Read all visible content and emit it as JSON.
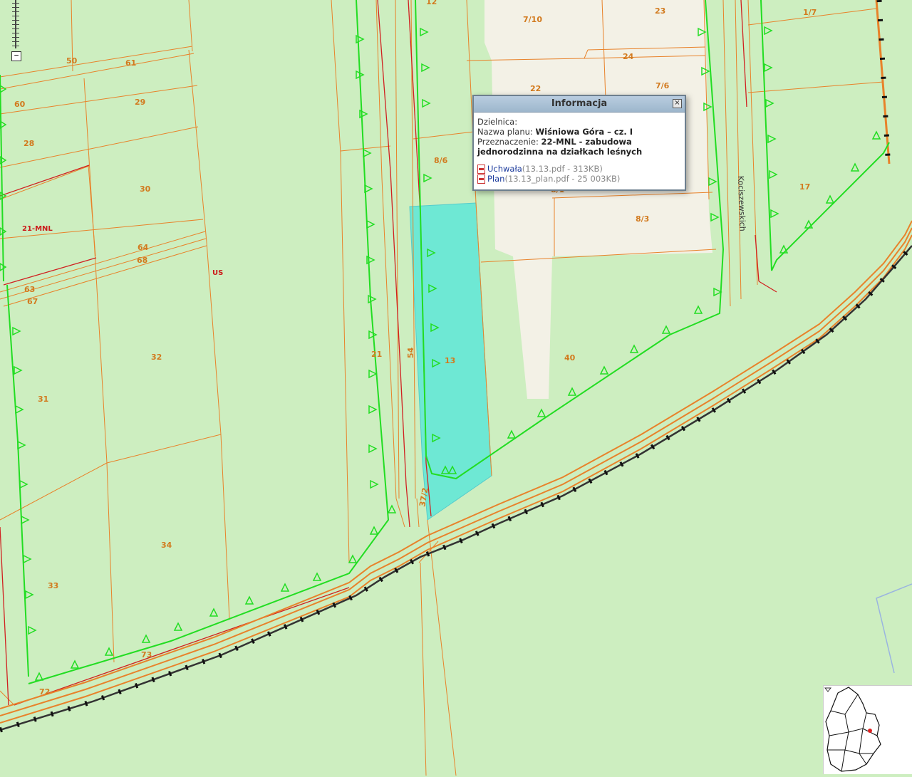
{
  "map": {
    "parcel_labels": [
      {
        "text": "12"
      },
      {
        "text": "7/10"
      },
      {
        "text": "23"
      },
      {
        "text": "1/7"
      },
      {
        "text": "50"
      },
      {
        "text": "61"
      },
      {
        "text": "24"
      },
      {
        "text": "29"
      },
      {
        "text": "60"
      },
      {
        "text": "22"
      },
      {
        "text": "7/6"
      },
      {
        "text": "28"
      },
      {
        "text": "8/6"
      },
      {
        "text": "17"
      },
      {
        "text": "30"
      },
      {
        "text": "8/1"
      },
      {
        "text": "8/3"
      },
      {
        "text": "64"
      },
      {
        "text": "68"
      },
      {
        "text": "63"
      },
      {
        "text": "67"
      },
      {
        "text": "32"
      },
      {
        "text": "21"
      },
      {
        "text": "54"
      },
      {
        "text": "13"
      },
      {
        "text": "40"
      },
      {
        "text": "31"
      },
      {
        "text": "37/2"
      },
      {
        "text": "34"
      },
      {
        "text": "33"
      },
      {
        "text": "73"
      },
      {
        "text": "72"
      }
    ],
    "zone_labels": [
      {
        "text": "21-MNL"
      },
      {
        "text": "US"
      }
    ],
    "street_label": "Kociszewskich"
  },
  "zoom": {
    "out_label": "−"
  },
  "popup": {
    "title": "Informacja",
    "close_icon": "close-icon",
    "dzielnica_label": "Dzielnica:",
    "dzielnica_value": "",
    "plan_label": "Nazwa planu: ",
    "plan_value": "Wiśniowa Góra – cz. I",
    "przeznaczenie_label": "Przeznaczenie: ",
    "przeznaczenie_value": "22-MNL - zabudowa jednorodzinna na działkach leśnych",
    "files": [
      {
        "icon": "pdf-icon",
        "link": "Uchwała",
        "meta": "(13.13.pdf - 313KB)"
      },
      {
        "icon": "pdf-icon",
        "link": "Plan",
        "meta": "(13.13_plan.pdf - 25 003KB)"
      }
    ]
  },
  "colors": {
    "background": "#cdeec0",
    "built_area": "#f3f1e6",
    "selected_parcel": "#6ee8d4",
    "parcel_border": "#e8822a",
    "plan_boundary": "#22dd22",
    "zone_border": "#d02020",
    "railway": "#111111"
  }
}
